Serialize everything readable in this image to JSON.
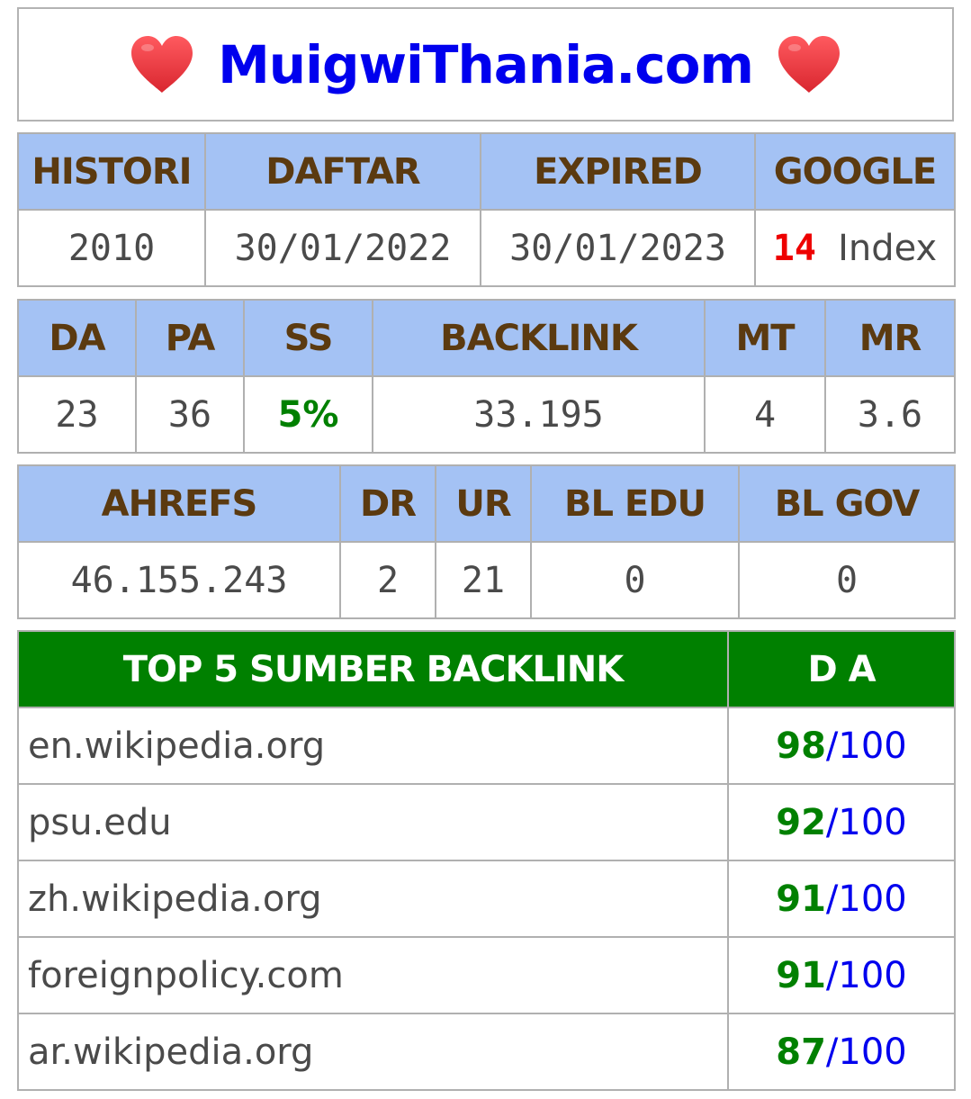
{
  "header": {
    "site_name": "MuigwiThania.com"
  },
  "domain_info": {
    "headers": [
      "HISTORI",
      "DAFTAR",
      "EXPIRED",
      "GOOGLE"
    ],
    "histori": "2010",
    "daftar": "30/01/2022",
    "expired": "30/01/2023",
    "google_count": "14",
    "google_label": "Index"
  },
  "moz": {
    "headers": [
      "DA",
      "PA",
      "SS",
      "BACKLINK",
      "MT",
      "MR"
    ],
    "da": "23",
    "pa": "36",
    "ss": "5%",
    "backlink": "33.195",
    "mt": "4",
    "mr": "3.6"
  },
  "ahrefs": {
    "headers": [
      "AHREFS",
      "DR",
      "UR",
      "BL EDU",
      "BL GOV"
    ],
    "ahrefs": "46.155.243",
    "dr": "2",
    "ur": "21",
    "bl_edu": "0",
    "bl_gov": "0"
  },
  "top_backlinks": {
    "title": "TOP 5 SUMBER BACKLINK",
    "da_header": "D A",
    "separator": "/",
    "rows": [
      {
        "site": "en.wikipedia.org",
        "da": "98",
        "max": "100"
      },
      {
        "site": "psu.edu",
        "da": "92",
        "max": "100"
      },
      {
        "site": "zh.wikipedia.org",
        "da": "91",
        "max": "100"
      },
      {
        "site": "foreignpolicy.com",
        "da": "91",
        "max": "100"
      },
      {
        "site": "ar.wikipedia.org",
        "da": "87",
        "max": "100"
      }
    ]
  },
  "colors": {
    "header_bg": "#a4c2f4",
    "header_text": "#5b3a10",
    "title_blue": "#0000ee",
    "green": "#008000",
    "red": "#ee0000",
    "heart": "#e8343f"
  },
  "icons": [
    "heart-icon"
  ]
}
